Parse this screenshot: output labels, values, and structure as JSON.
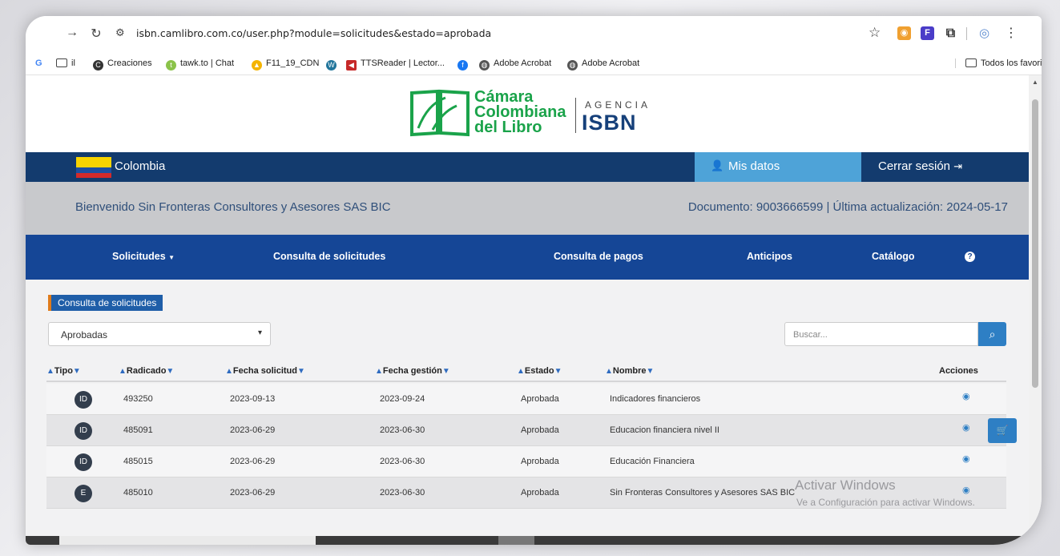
{
  "browser": {
    "url": "isbn.camlibro.com.co/user.php?module=solicitudes&estado=aprobada",
    "bookmarks": [
      {
        "label": "il",
        "icon": "folder-icon"
      },
      {
        "label": "Creaciones",
        "icon": "circle-c-icon"
      },
      {
        "label": "tawk.to | Chat",
        "icon": "tawk-icon"
      },
      {
        "label": "F11_19_CDN",
        "icon": "drive-icon"
      },
      {
        "label": "",
        "icon": "wordpress-icon"
      },
      {
        "label": "TTSReader | Lector...",
        "icon": "tts-icon"
      },
      {
        "label": "",
        "icon": "facebook-icon"
      },
      {
        "label": "Adobe Acrobat",
        "icon": "globe-icon"
      },
      {
        "label": "Adobe Acrobat",
        "icon": "globe-icon"
      }
    ],
    "all_bookmarks": "Todos los favoritos"
  },
  "logo": {
    "line1": "Cámara",
    "line2": "Colombiana",
    "line3": "del Libro",
    "agencia": "AGENCIA",
    "isbn": "ISBN"
  },
  "topbar": {
    "country": "Colombia",
    "mis_datos": "Mis datos",
    "cerrar": "Cerrar sesión"
  },
  "welcome": {
    "greeting": "Bienvenido Sin Fronteras Consultores y Asesores SAS BIC",
    "document": "Documento: 9003666599 | Última actualización: 2024-05-17"
  },
  "nav": {
    "solicitudes": "Solicitudes",
    "consulta_solicitudes": "Consulta de solicitudes",
    "consulta_pagos": "Consulta de pagos",
    "anticipos": "Anticipos",
    "catalogo": "Catálogo"
  },
  "content": {
    "badge": "Consulta de solicitudes",
    "filter_value": "Aprobadas",
    "search_placeholder": "Buscar..."
  },
  "table": {
    "headers": {
      "tipo": "Tipo",
      "radicado": "Radicado",
      "fecha_solicitud": "Fecha solicitud",
      "fecha_gestion": "Fecha gestión",
      "estado": "Estado",
      "nombre": "Nombre",
      "acciones": "Acciones"
    },
    "rows": [
      {
        "tipo": "ID",
        "radicado": "493250",
        "fecha_solicitud": "2023-09-13",
        "fecha_gestion": "2023-09-24",
        "estado": "Aprobada",
        "nombre": "Indicadores financieros"
      },
      {
        "tipo": "ID",
        "radicado": "485091",
        "fecha_solicitud": "2023-06-29",
        "fecha_gestion": "2023-06-30",
        "estado": "Aprobada",
        "nombre": "Educacion financiera nivel II"
      },
      {
        "tipo": "ID",
        "radicado": "485015",
        "fecha_solicitud": "2023-06-29",
        "fecha_gestion": "2023-06-30",
        "estado": "Aprobada",
        "nombre": "Educación Financiera"
      },
      {
        "tipo": "E",
        "radicado": "485010",
        "fecha_solicitud": "2023-06-29",
        "fecha_gestion": "2023-06-30",
        "estado": "Aprobada",
        "nombre": "Sin Fronteras Consultores y Asesores SAS BIC"
      }
    ]
  },
  "watermark": {
    "line1": "Activar Windows",
    "line2": "Ve a Configuración para activar Windows."
  },
  "colors": {
    "brand_green": "#1aa34a",
    "navy": "#133b6e",
    "nav_blue": "#154696",
    "accent_blue": "#2e7fc4"
  }
}
